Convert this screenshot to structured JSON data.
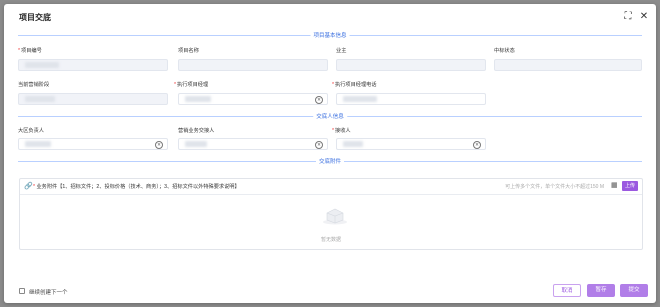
{
  "dialog": {
    "title": "项目交底",
    "fullscreen_icon": "fullscreen-icon",
    "close_icon": "close-icon"
  },
  "sections": {
    "basic": "项目基本信息",
    "handover": "交底人信息",
    "attachments": "交底附件"
  },
  "fields": {
    "project_code": {
      "label": "项目编号",
      "required": "*"
    },
    "project_name": {
      "label": "项目名称"
    },
    "owner": {
      "label": "业主"
    },
    "bid_status": {
      "label": "中标状态"
    },
    "current_sales_stage": {
      "label": "当前营销阶段"
    },
    "exec_pm": {
      "label": "执行项目经理",
      "required": "*"
    },
    "exec_pm_phone": {
      "label": "执行项目经理电话",
      "required": "*"
    },
    "region_head": {
      "label": "大区负责人"
    },
    "sales_handover_person": {
      "label": "营销业务交接人"
    },
    "receiver": {
      "label": "接收人",
      "required": "*"
    }
  },
  "attachments": {
    "title": "业务附件【1、招标文件；2、投标价格（技术、商务）；3、招标文件以外特殊要求说明】",
    "required": "*",
    "hint": "可上传多个文件，单个文件大小不超过150 M",
    "upload_label": "上传",
    "empty_text": "暂无数据"
  },
  "footer": {
    "continue_label": "继续创建下一个",
    "cancel_label": "取消",
    "save_label": "暂存",
    "submit_label": "提交"
  },
  "colors": {
    "accent": "#b17ee8",
    "section_blue": "#3a6fe0",
    "required_red": "#e33333"
  }
}
